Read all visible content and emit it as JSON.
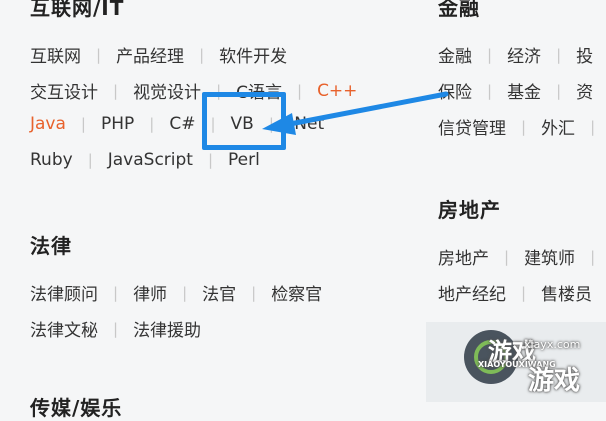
{
  "sections": {
    "internet_it": {
      "title": "互联网/IT",
      "rows": [
        [
          "互联网",
          "产品经理",
          "软件开发"
        ],
        [
          "交互设计",
          "视觉设计",
          "C语言",
          "C++"
        ],
        [
          "Java",
          "PHP",
          "C#",
          "VB",
          ".Net"
        ],
        [
          "Ruby",
          "JavaScript",
          "Perl"
        ]
      ],
      "highlighted": [
        "C++",
        "Java"
      ]
    },
    "law": {
      "title": "法律",
      "rows": [
        [
          "法律顾问",
          "律师",
          "法官",
          "检察官"
        ],
        [
          "法律文秘",
          "法律援助"
        ]
      ]
    },
    "finance": {
      "title": "金融",
      "rows": [
        [
          "金融",
          "经济",
          "投"
        ],
        [
          "保险",
          "基金",
          "资"
        ],
        [
          "信贷管理",
          "外汇"
        ]
      ]
    },
    "real_estate": {
      "title": "房地产",
      "rows": [
        [
          "房地产",
          "建筑师"
        ],
        [
          "地产经纪",
          "售楼员"
        ]
      ]
    },
    "bottom_partial": {
      "title": "传媒/娱乐"
    }
  },
  "watermark": {
    "brand": "游戏",
    "sub": "xiayx.com",
    "pinyin": "XIAOYOUXIWANG",
    "brand2": "游戏"
  },
  "colors": {
    "highlight": "#e8622c",
    "annotation": "#1e88e5"
  }
}
